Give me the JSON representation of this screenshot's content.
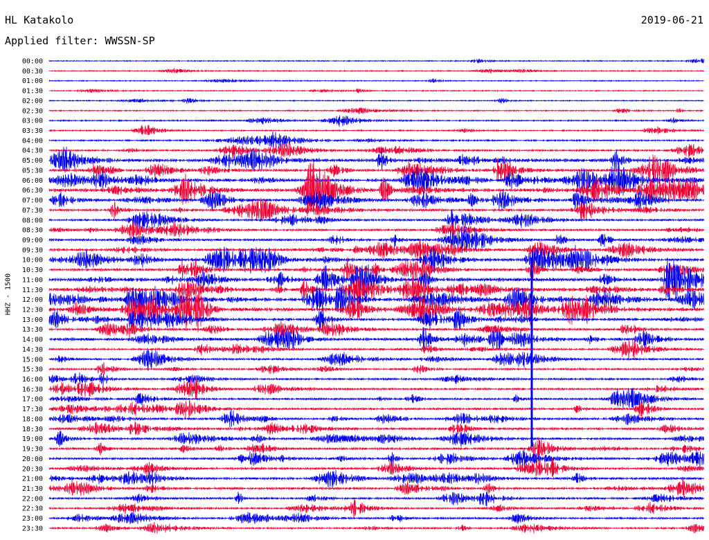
{
  "header": {
    "station": "HL Katakolo",
    "date": "2019-06-21",
    "filter": "Applied filter: WWSSN-SP"
  },
  "chart_data": {
    "type": "line",
    "chart_kind": "helicorder",
    "ylabel": "HHZ - 1500",
    "colors": [
      "#0000ee",
      "#ee0033"
    ],
    "traces": [
      {
        "time": "00:00",
        "color": "#0000ee",
        "activity": 0.1
      },
      {
        "time": "00:30",
        "color": "#ee0033",
        "activity": 0.12
      },
      {
        "time": "01:00",
        "color": "#0000ee",
        "activity": 0.1
      },
      {
        "time": "01:30",
        "color": "#ee0033",
        "activity": 0.12
      },
      {
        "time": "02:00",
        "color": "#0000ee",
        "activity": 0.12
      },
      {
        "time": "02:30",
        "color": "#ee0033",
        "activity": 0.15
      },
      {
        "time": "03:00",
        "color": "#0000ee",
        "activity": 0.2
      },
      {
        "time": "03:30",
        "color": "#ee0033",
        "activity": 0.2
      },
      {
        "time": "04:00",
        "color": "#0000ee",
        "activity": 0.25
      },
      {
        "time": "04:30",
        "color": "#ee0033",
        "activity": 0.4
      },
      {
        "time": "05:00",
        "color": "#0000ee",
        "activity": 0.85
      },
      {
        "time": "05:30",
        "color": "#ee0033",
        "activity": 0.7
      },
      {
        "time": "06:00",
        "color": "#0000ee",
        "activity": 0.9
      },
      {
        "time": "06:30",
        "color": "#ee0033",
        "activity": 0.9
      },
      {
        "time": "07:00",
        "color": "#0000ee",
        "activity": 0.7
      },
      {
        "time": "07:30",
        "color": "#ee0033",
        "activity": 0.6
      },
      {
        "time": "08:00",
        "color": "#0000ee",
        "activity": 0.45
      },
      {
        "time": "08:30",
        "color": "#ee0033",
        "activity": 0.5
      },
      {
        "time": "09:00",
        "color": "#0000ee",
        "activity": 0.6
      },
      {
        "time": "09:30",
        "color": "#ee0033",
        "activity": 0.65
      },
      {
        "time": "10:00",
        "color": "#0000ee",
        "activity": 0.8
      },
      {
        "time": "10:30",
        "color": "#ee0033",
        "activity": 0.7
      },
      {
        "time": "11:00",
        "color": "#0000ee",
        "activity": 0.95
      },
      {
        "time": "11:30",
        "color": "#ee0033",
        "activity": 0.9
      },
      {
        "time": "12:00",
        "color": "#0000ee",
        "activity": 1.0
      },
      {
        "time": "12:30",
        "color": "#ee0033",
        "activity": 1.0
      },
      {
        "time": "13:00",
        "color": "#0000ee",
        "activity": 0.7
      },
      {
        "time": "13:30",
        "color": "#ee0033",
        "activity": 0.55
      },
      {
        "time": "14:00",
        "color": "#0000ee",
        "activity": 0.8
      },
      {
        "time": "14:30",
        "color": "#ee0033",
        "activity": 0.45
      },
      {
        "time": "15:00",
        "color": "#0000ee",
        "activity": 0.45
      },
      {
        "time": "15:30",
        "color": "#ee0033",
        "activity": 0.45
      },
      {
        "time": "16:00",
        "color": "#0000ee",
        "activity": 0.45
      },
      {
        "time": "16:30",
        "color": "#ee0033",
        "activity": 0.45
      },
      {
        "time": "17:00",
        "color": "#0000ee",
        "activity": 0.45
      },
      {
        "time": "17:30",
        "color": "#ee0033",
        "activity": 0.5
      },
      {
        "time": "18:00",
        "color": "#0000ee",
        "activity": 0.55
      },
      {
        "time": "18:30",
        "color": "#ee0033",
        "activity": 0.55
      },
      {
        "time": "19:00",
        "color": "#0000ee",
        "activity": 0.55
      },
      {
        "time": "19:30",
        "color": "#ee0033",
        "activity": 0.55
      },
      {
        "time": "20:00",
        "color": "#0000ee",
        "activity": 0.55
      },
      {
        "time": "20:30",
        "color": "#ee0033",
        "activity": 0.55
      },
      {
        "time": "21:00",
        "color": "#0000ee",
        "activity": 0.6
      },
      {
        "time": "21:30",
        "color": "#ee0033",
        "activity": 0.55
      },
      {
        "time": "22:00",
        "color": "#0000ee",
        "activity": 0.45
      },
      {
        "time": "22:30",
        "color": "#ee0033",
        "activity": 0.4
      },
      {
        "time": "23:00",
        "color": "#0000ee",
        "activity": 0.4
      },
      {
        "time": "23:30",
        "color": "#ee0033",
        "activity": 0.4
      }
    ]
  }
}
